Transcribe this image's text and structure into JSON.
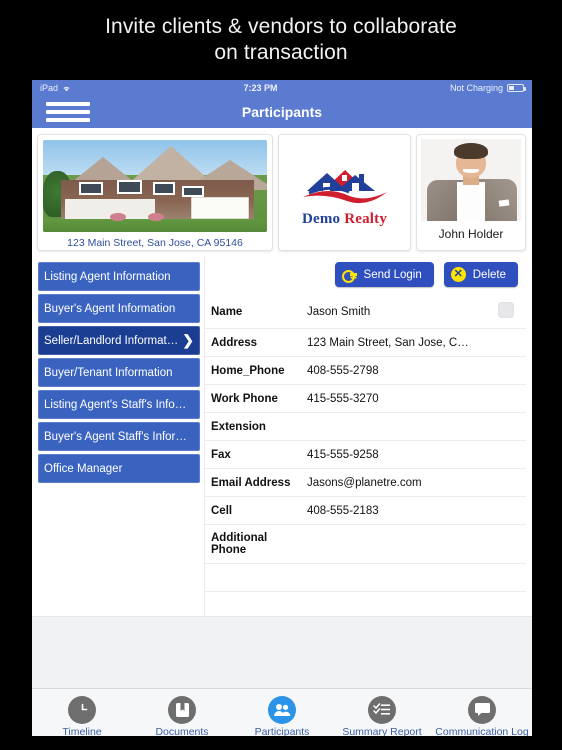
{
  "promo": {
    "line1": "Invite clients & vendors to collaborate",
    "line2": "on transaction"
  },
  "statusbar": {
    "device": "iPad",
    "wifi_icon": "wifi-icon",
    "time": "7:23 PM",
    "battery_text": "Not Charging",
    "battery_icon": "battery-icon"
  },
  "navbar": {
    "menu_icon": "hamburger-menu-icon",
    "title": "Participants"
  },
  "cards": {
    "property": {
      "image_name": "property-photo",
      "caption": "123 Main Street, San Jose, CA 95146"
    },
    "brokerage": {
      "image_name": "demo-realty-logo",
      "word1": "Demo",
      "word2": "Realty"
    },
    "agent": {
      "image_name": "agent-headshot",
      "caption": "John Holder"
    }
  },
  "sidebar": {
    "items": [
      {
        "label": "Listing Agent Information",
        "selected": false
      },
      {
        "label": "Buyer's Agent Information",
        "selected": false
      },
      {
        "label": "Seller/Landlord Information",
        "selected": true,
        "chevron": "❯"
      },
      {
        "label": "Buyer/Tenant Information",
        "selected": false
      },
      {
        "label": "Listing Agent's Staff's Info…",
        "selected": false
      },
      {
        "label": "Buyer's Agent Staff's Infor…",
        "selected": false
      },
      {
        "label": "Office Manager",
        "selected": false
      }
    ]
  },
  "actions": {
    "send_login": {
      "label": "Send Login",
      "icon": "key-icon"
    },
    "delete": {
      "label": "Delete",
      "icon": "x-circle-icon",
      "glyph": "✕"
    }
  },
  "form": {
    "rows": [
      {
        "label": "Name",
        "value": "Jason Smith",
        "has_checkbox": true
      },
      {
        "label": "Address",
        "value": "123 Main Street, San Jose, C…",
        "has_checkbox": false
      },
      {
        "label": "Home_Phone",
        "value": "408-555-2798",
        "has_checkbox": false
      },
      {
        "label": "Work Phone",
        "value": "415-555-3270",
        "has_checkbox": false
      },
      {
        "label": "Extension",
        "value": "",
        "has_checkbox": false
      },
      {
        "label": "Fax",
        "value": "415-555-9258",
        "has_checkbox": false
      },
      {
        "label": "Email Address",
        "value": "Jasons@planetre.com",
        "has_checkbox": false
      },
      {
        "label": "Cell",
        "value": "408-555-2183",
        "has_checkbox": false
      },
      {
        "label": "Additional Phone",
        "value": "",
        "has_checkbox": false
      }
    ]
  },
  "tabbar": {
    "tabs": [
      {
        "label": "Timeline",
        "icon": "clock-icon",
        "active": false
      },
      {
        "label": "Documents",
        "icon": "book-icon",
        "active": false
      },
      {
        "label": "Participants",
        "icon": "people-icon",
        "active": true
      },
      {
        "label": "Summary Report",
        "icon": "checklist-icon",
        "active": false
      },
      {
        "label": "Communication Log",
        "icon": "chat-icon",
        "active": false
      }
    ]
  },
  "colors": {
    "nav_blue": "#5a7bd0",
    "sidebar_blue": "#3a63c0",
    "sidebar_selected": "#1c3e92",
    "button_blue": "#2f4fbe",
    "accent_yellow": "#ffe400",
    "tab_active": "#2b93e8",
    "tab_label": "#3c5ea8"
  }
}
